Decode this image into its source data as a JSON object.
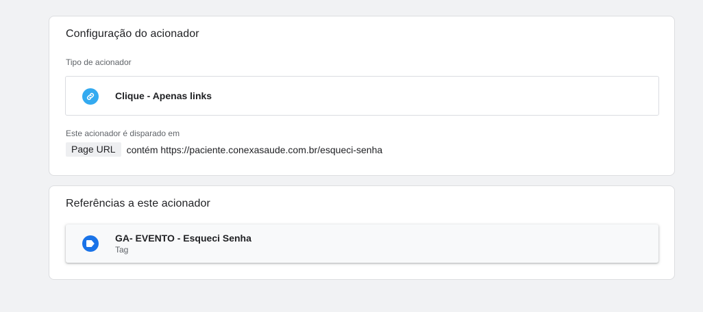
{
  "config_card": {
    "title": "Configuração do acionador",
    "trigger_type_label": "Tipo de acionador",
    "trigger_type": {
      "icon": "link-icon",
      "icon_color": "#33aaf0",
      "name": "Clique - Apenas links"
    },
    "fires_on_label": "Este acionador é disparado em",
    "condition": {
      "variable": "Page URL",
      "text": "contém https://paciente.conexasaude.com.br/esqueci-senha"
    }
  },
  "references_card": {
    "title": "Referências a este acionador",
    "items": [
      {
        "icon": "tag-icon",
        "icon_color": "#1a73e8",
        "name": "GA- EVENTO - Esqueci Senha",
        "type": "Tag"
      }
    ]
  }
}
